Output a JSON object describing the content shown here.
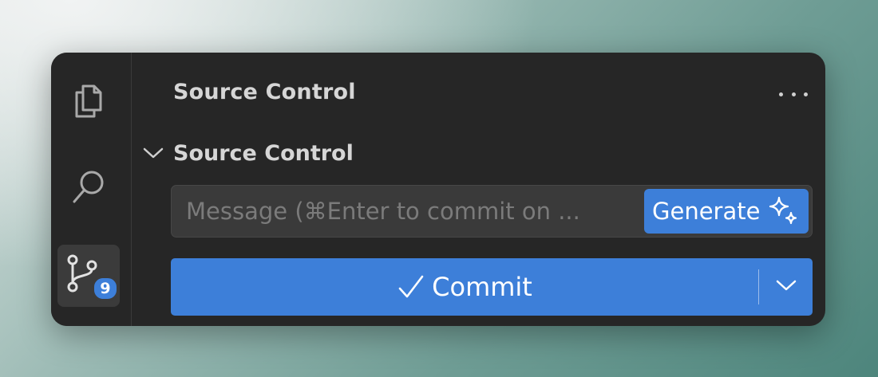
{
  "activity_bar": {
    "items": [
      {
        "name": "explorer",
        "icon": "files-icon",
        "active": false
      },
      {
        "name": "search",
        "icon": "search-icon",
        "active": false
      },
      {
        "name": "source-control",
        "icon": "source-control-icon",
        "active": true,
        "badge": "9"
      }
    ]
  },
  "panel": {
    "title": "Source Control",
    "more_icon": "ellipsis-icon"
  },
  "section": {
    "title": "Source Control",
    "expanded": true
  },
  "message": {
    "placeholder": "Message (⌘Enter to commit on ...",
    "value": ""
  },
  "generate_button": {
    "label": "Generate",
    "icon": "sparkle-icon"
  },
  "commit_button": {
    "label": "Commit",
    "icon": "check-icon",
    "dropdown_icon": "chevron-down-icon"
  },
  "colors": {
    "accent": "#3d7fd9",
    "window_bg": "#262626",
    "input_bg": "#3a3a3a",
    "text": "#d6d6d6"
  }
}
